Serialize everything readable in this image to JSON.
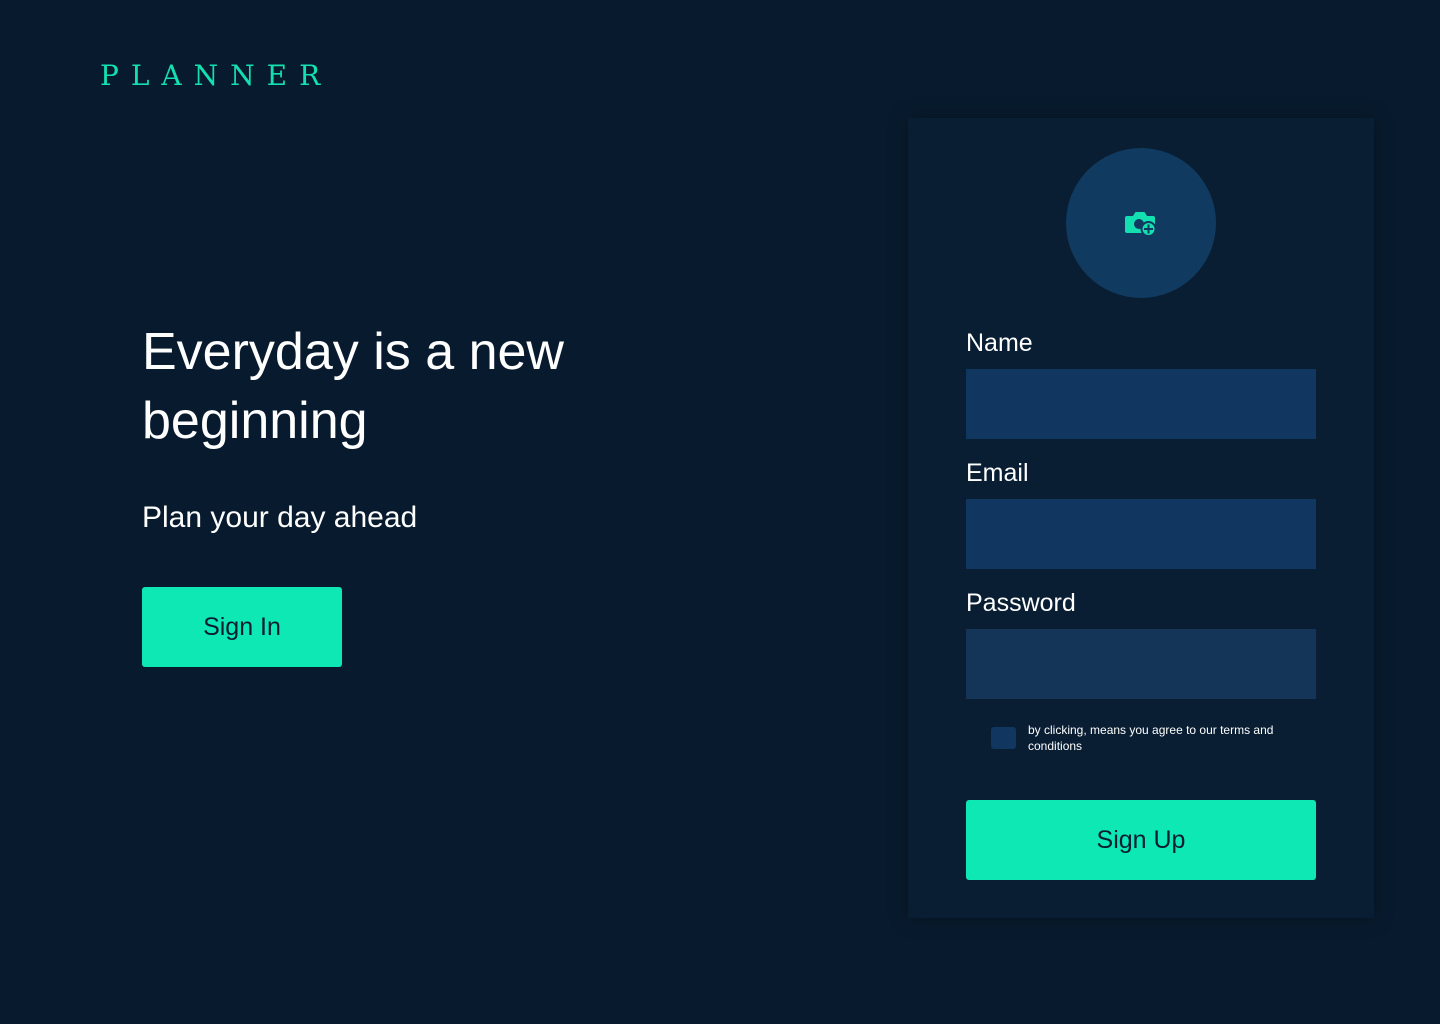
{
  "brand": {
    "logo_text": "PLANNER"
  },
  "hero": {
    "title": "Everyday is a new beginning",
    "subtitle": "Plan your day ahead",
    "signin_label": "Sign In"
  },
  "signup_form": {
    "avatar_icon": "camera-add-icon",
    "fields": [
      {
        "label": "Name",
        "value": "",
        "placeholder": ""
      },
      {
        "label": "Email",
        "value": "",
        "placeholder": ""
      },
      {
        "label": "Password",
        "value": "",
        "placeholder": ""
      }
    ],
    "terms_text": "by clicking, means you agree to our terms and conditions",
    "terms_checked": false,
    "submit_label": "Sign Up"
  },
  "colors": {
    "background": "#081b2e",
    "card": "#091e33",
    "input": "#113760",
    "avatar": "#103a60",
    "accent": "#0ee8b4",
    "button_text": "#0a1d33"
  }
}
